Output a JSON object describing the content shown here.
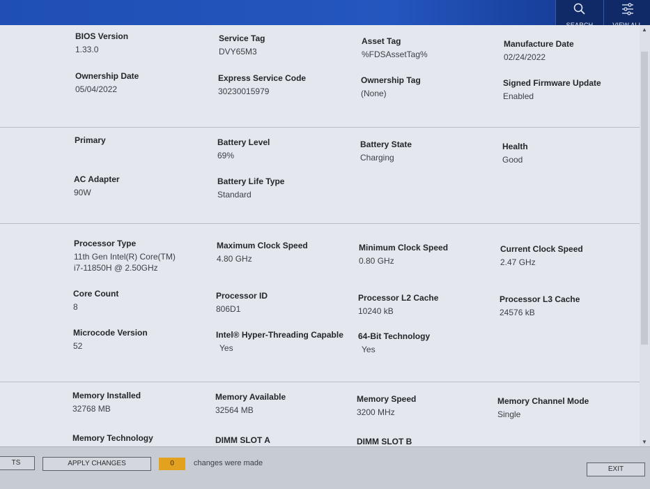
{
  "toolbar": {
    "search_label": "SEARCH",
    "view_all_label": "VIEW ALL"
  },
  "sections": {
    "system": [
      {
        "label": "BIOS Version",
        "value": "1.33.0"
      },
      {
        "label": "Service Tag",
        "value": "DVY65M3"
      },
      {
        "label": "Asset Tag",
        "value": "%FDSAssetTag%"
      },
      {
        "label": "Manufacture Date",
        "value": "02/24/2022"
      },
      {
        "label": "Ownership Date",
        "value": "05/04/2022"
      },
      {
        "label": "Express Service Code",
        "value": "30230015979"
      },
      {
        "label": "Ownership Tag",
        "value": "(None)"
      },
      {
        "label": "Signed Firmware Update",
        "value": "Enabled"
      }
    ],
    "battery": [
      {
        "label": "Primary",
        "value": ""
      },
      {
        "label": "Battery Level",
        "value": "69%"
      },
      {
        "label": "Battery State",
        "value": "Charging"
      },
      {
        "label": "Health",
        "value": "Good"
      },
      {
        "label": "AC Adapter",
        "value": "90W"
      },
      {
        "label": "Battery Life Type",
        "value": "Standard"
      }
    ],
    "processor": [
      {
        "label": "Processor Type",
        "value": "11th Gen Intel(R) Core(TM)",
        "value2": "i7-11850H @ 2.50GHz"
      },
      {
        "label": "Maximum Clock Speed",
        "value": "4.80 GHz"
      },
      {
        "label": "Minimum Clock Speed",
        "value": "0.80 GHz"
      },
      {
        "label": "Current Clock Speed",
        "value": "2.47 GHz"
      },
      {
        "label": "Core Count",
        "value": "8"
      },
      {
        "label": "Processor ID",
        "value": "806D1"
      },
      {
        "label": "Processor L2 Cache",
        "value": "10240 kB"
      },
      {
        "label": "Processor L3 Cache",
        "value": "24576 kB"
      },
      {
        "label": "Microcode Version",
        "value": "52"
      },
      {
        "label": "Intel® Hyper-Threading Capable",
        "value": "Yes"
      },
      {
        "label": "64-Bit Technology",
        "value": "Yes"
      }
    ],
    "memory": [
      {
        "label": "Memory Installed",
        "value": "32768 MB"
      },
      {
        "label": "Memory Available",
        "value": "32564 MB"
      },
      {
        "label": "Memory Speed",
        "value": "3200 MHz"
      },
      {
        "label": "Memory Channel Mode",
        "value": "Single"
      },
      {
        "label": "Memory Technology",
        "value": ""
      },
      {
        "label": "DIMM SLOT A",
        "value": ""
      },
      {
        "label": "DIMM SLOT B",
        "value": ""
      }
    ]
  },
  "footer": {
    "defaults_label": "TS",
    "apply_label": "APPLY CHANGES",
    "changes_count": "0",
    "changes_text": "changes were made",
    "exit_label": "EXIT"
  }
}
